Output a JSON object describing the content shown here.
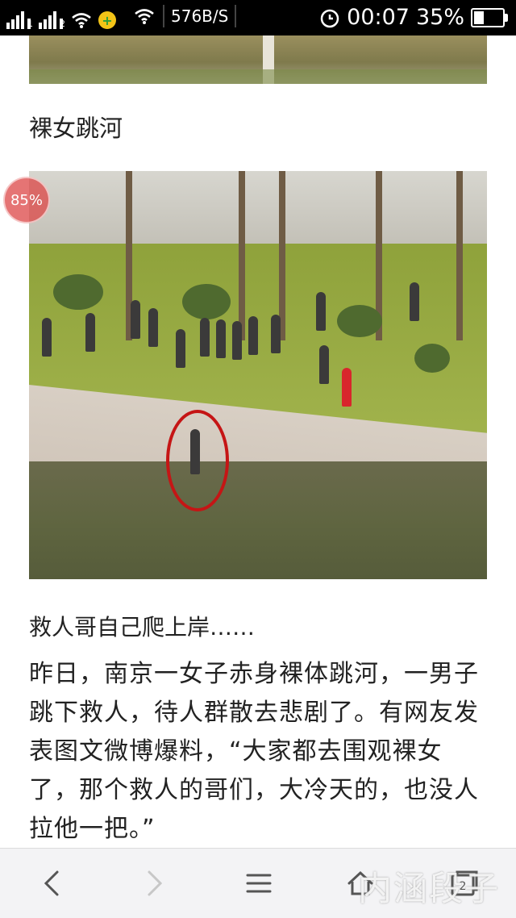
{
  "status_bar": {
    "sig1_label": "1",
    "sig2_label": "2",
    "net_speed": "576B/S",
    "time": "00:07",
    "battery_percent": "35%",
    "battery_level": 0.35
  },
  "content": {
    "caption_top": "裸女跳河",
    "zoom_badge": "85%",
    "caption_photo": "救人哥自己爬上岸……",
    "article_text": "昨日，南京一女子赤身裸体跳河，一男子跳下救人，待人群散去悲剧了。有网友发表图文微博爆料，“大家都去围观裸女了，那个救人的哥们，大冷天的，也没人拉他一把。”"
  },
  "bottom_bar": {
    "tabs_count": "2",
    "watermark": "内涵段子"
  },
  "icons": {
    "signal": "signal-icon",
    "wifi": "wifi-icon",
    "app": "app-icon",
    "alarm": "alarm-icon",
    "battery": "battery-icon",
    "back": "back-arrow-icon",
    "forward": "forward-arrow-icon",
    "menu": "menu-icon",
    "home": "home-icon",
    "tabs": "tabs-icon"
  }
}
